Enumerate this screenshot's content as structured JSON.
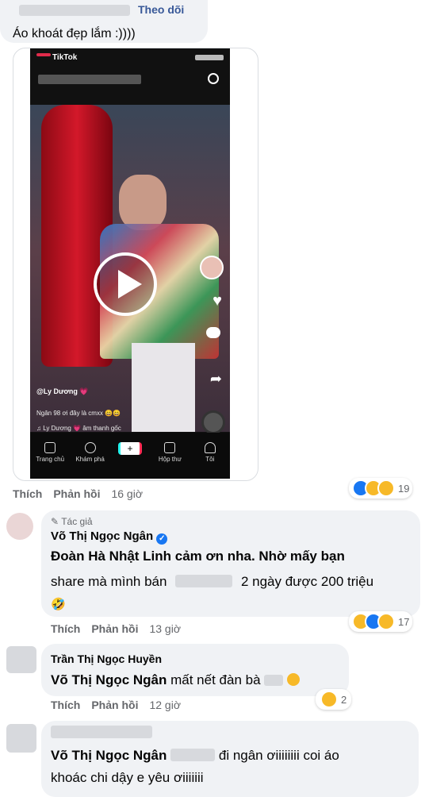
{
  "top_comment": {
    "follow_label": "Theo dõi",
    "text": "Áo khoát đẹp lắm :))))"
  },
  "tiktok": {
    "brand": "TikTok",
    "caption_user": "@Ly Dương 💗",
    "caption_line": "Ngân 98 ơi đây là cmxx 😄😄",
    "music_line": "♫ Ly Dương 💗 âm thanh gốc",
    "nav": [
      "Trang chủ",
      "Khám phá",
      "+",
      "Hộp thư",
      "Tôi"
    ]
  },
  "post_actions": {
    "like": "Thích",
    "reply": "Phản hồi",
    "time": "16 giờ",
    "react_count": "19"
  },
  "reply1": {
    "author_badge": "Tác giả",
    "author": "Võ Thị Ngọc Ngân",
    "line1": "Đoàn Hà Nhật Linh cảm ơn nha. Nhờ mấy bạn",
    "line2a": "share mà mình bán",
    "line2b": "2 ngày được 200 triệu",
    "line3": "🤣",
    "like": "Thích",
    "reply": "Phản hồi",
    "time": "13 giờ",
    "react_count": "17"
  },
  "reply2": {
    "author": "Trần Thị Ngọc Huyền",
    "mention": "Võ Thị Ngọc Ngân",
    "rest": "mất nết đàn bà",
    "like": "Thích",
    "reply": "Phản hồi",
    "time": "12 giờ",
    "react_count": "2"
  },
  "reply3": {
    "mention": "Võ Thị Ngọc Ngân",
    "line1_rest": "đi ngân ơiiiiiiii coi áo",
    "line2": "khoác chi dậy e yêu ơiiiiiii"
  },
  "colors": {
    "link": "#385898",
    "meta": "#65676b",
    "bubble": "#f0f2f5",
    "verified": "#1877f2"
  }
}
